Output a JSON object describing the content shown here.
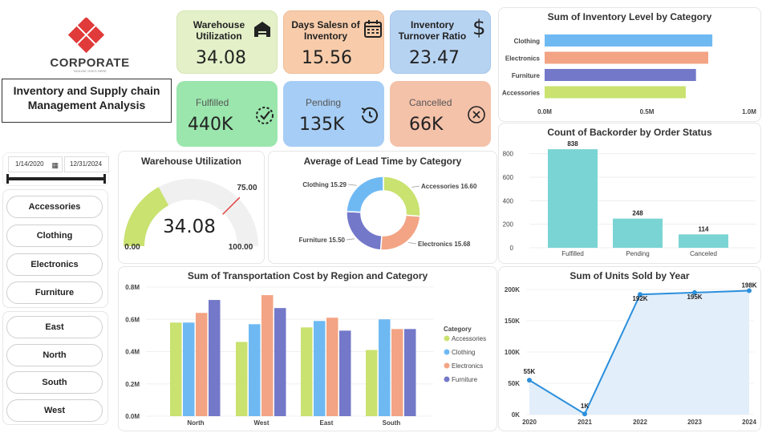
{
  "brand": {
    "name": "CORPORATE",
    "tagline": "TAGLINE GOES HERE"
  },
  "report_title": "Inventory and Supply chain Management Analysis",
  "kpis": [
    {
      "title": "Warehouse Utilization",
      "value": "34.08",
      "icon": "warehouse-icon",
      "color": "#e3f0c8"
    },
    {
      "title": "Days Salesn of Inventory",
      "value": "15.56",
      "icon": "calendar-icon",
      "color": "#f8ccaa"
    },
    {
      "title": "Inventory Turnover Ratio",
      "value": "23.47",
      "icon": "dollar-icon",
      "color": "#b7d3f2"
    }
  ],
  "status_cards": [
    {
      "label": "Fulfilled",
      "value": "440K",
      "icon": "check-circle-icon",
      "color": "#9be6ad"
    },
    {
      "label": "Pending",
      "value": "135K",
      "icon": "clock-icon",
      "color": "#a6cdf5"
    },
    {
      "label": "Cancelled",
      "value": "66K",
      "icon": "cancel-icon",
      "color": "#f4c1a9"
    }
  ],
  "date_slicer": {
    "start": "1/14/2020",
    "end": "12/31/2024"
  },
  "category_slicer": [
    "Accessories",
    "Clothing",
    "Electronics",
    "Furniture"
  ],
  "region_slicer": [
    "East",
    "North",
    "South",
    "West"
  ],
  "colors": {
    "accessories": "#c9e270",
    "clothing": "#6fb9f3",
    "electronics": "#f3a484",
    "furniture": "#7378c9",
    "teal": "#7ad4d4",
    "line": "#2b8fdc"
  },
  "chart_data": [
    {
      "type": "bar",
      "title": "Sum of Inventory Level by Category",
      "orientation": "horizontal",
      "categories": [
        "Clothing",
        "Electronics",
        "Furniture",
        "Accessories"
      ],
      "values": [
        0.82,
        0.8,
        0.74,
        0.69
      ],
      "unit": "M",
      "xlim": [
        0,
        1.0
      ],
      "ticks": [
        "0.0M",
        "0.5M",
        "1.0M"
      ]
    },
    {
      "type": "bar",
      "title": "Count of Backorder by Order Status",
      "categories": [
        "Fulfilled",
        "Pending",
        "Canceled"
      ],
      "values": [
        838,
        248,
        114
      ],
      "ylim": [
        0,
        900
      ],
      "ticks": [
        "0",
        "200",
        "400",
        "600",
        "800"
      ]
    },
    {
      "type": "gauge",
      "title": "Warehouse Utilization",
      "value": 34.08,
      "min": 0,
      "max": 100,
      "target": 75,
      "value_label": "34.08",
      "min_label": "0.00",
      "max_label": "100.00",
      "target_label": "75.00"
    },
    {
      "type": "pie",
      "title": "Average of Lead Time by Category",
      "categories": [
        "Accessories",
        "Electronics",
        "Furniture",
        "Clothing"
      ],
      "values": [
        16.6,
        15.68,
        15.5,
        15.29
      ],
      "labels": [
        "Accessories 16.60",
        "Electronics 15.68",
        "Furniture 15.50",
        "Clothing 15.29"
      ]
    },
    {
      "type": "bar",
      "title": "Sum of Transportation Cost by Region and Category",
      "categories": [
        "North",
        "West",
        "East",
        "South"
      ],
      "legend_title": "Category",
      "series": [
        {
          "name": "Accessories",
          "values": [
            0.58,
            0.46,
            0.55,
            0.41
          ]
        },
        {
          "name": "Clothing",
          "values": [
            0.58,
            0.57,
            0.59,
            0.6
          ]
        },
        {
          "name": "Electronics",
          "values": [
            0.64,
            0.75,
            0.61,
            0.54
          ]
        },
        {
          "name": "Furniture",
          "values": [
            0.72,
            0.67,
            0.53,
            0.54
          ]
        }
      ],
      "ylim": [
        0,
        0.8
      ],
      "ticks": [
        "0.0M",
        "0.2M",
        "0.4M",
        "0.6M",
        "0.8M"
      ]
    },
    {
      "type": "area",
      "title": "Sum of Units Sold by Year",
      "x": [
        "2020",
        "2021",
        "2022",
        "2023",
        "2024"
      ],
      "values": [
        55,
        1,
        192,
        195,
        198
      ],
      "labels": [
        "55K",
        "1K",
        "192K",
        "195K",
        "198K"
      ],
      "ylim": [
        0,
        200
      ],
      "ticks": [
        "0K",
        "50K",
        "100K",
        "150K",
        "200K"
      ]
    }
  ]
}
